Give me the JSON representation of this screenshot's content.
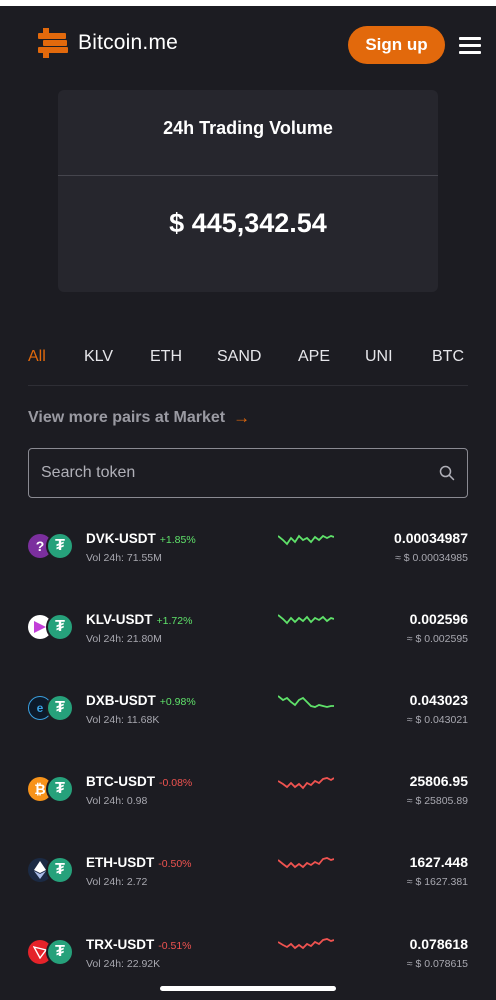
{
  "header": {
    "logo_text": "Bitcoin.me",
    "signup_label": "Sign up"
  },
  "volume": {
    "title": "24h Trading Volume",
    "value": "$ 445,342.54"
  },
  "tabs": [
    "All",
    "KLV",
    "ETH",
    "SAND",
    "APE",
    "UNI",
    "BTC"
  ],
  "view_more": "View more pairs at Market",
  "search": {
    "placeholder": "Search token"
  },
  "colors": {
    "accent": "#e2690c",
    "positive": "#5fe26a",
    "negative": "#ef5350",
    "tether": "#26a17b"
  },
  "pairs": [
    {
      "pair": "DVK-USDT",
      "change": "+1.85%",
      "trend": "up",
      "vol": "Vol 24h: 71.55M",
      "price": "0.00034987",
      "sub": "≈ $ 0.00034985",
      "icon": "dvk-coin-icon"
    },
    {
      "pair": "KLV-USDT",
      "change": "+1.72%",
      "trend": "up",
      "vol": "Vol 24h: 21.80M",
      "price": "0.002596",
      "sub": "≈ $ 0.002595",
      "icon": "klv-coin-icon"
    },
    {
      "pair": "DXB-USDT",
      "change": "+0.98%",
      "trend": "up",
      "vol": "Vol 24h: 11.68K",
      "price": "0.043023",
      "sub": "≈ $ 0.043021",
      "icon": "dxb-coin-icon"
    },
    {
      "pair": "BTC-USDT",
      "change": "-0.08%",
      "trend": "down",
      "vol": "Vol 24h: 0.98",
      "price": "25806.95",
      "sub": "≈ $ 25805.89",
      "icon": "btc-coin-icon"
    },
    {
      "pair": "ETH-USDT",
      "change": "-0.50%",
      "trend": "down",
      "vol": "Vol 24h: 2.72",
      "price": "1627.448",
      "sub": "≈ $ 1627.381",
      "icon": "eth-coin-icon"
    },
    {
      "pair": "TRX-USDT",
      "change": "-0.51%",
      "trend": "down",
      "vol": "Vol 24h: 22.92K",
      "price": "0.078618",
      "sub": "≈ $ 0.078615",
      "icon": "trx-coin-icon"
    }
  ]
}
